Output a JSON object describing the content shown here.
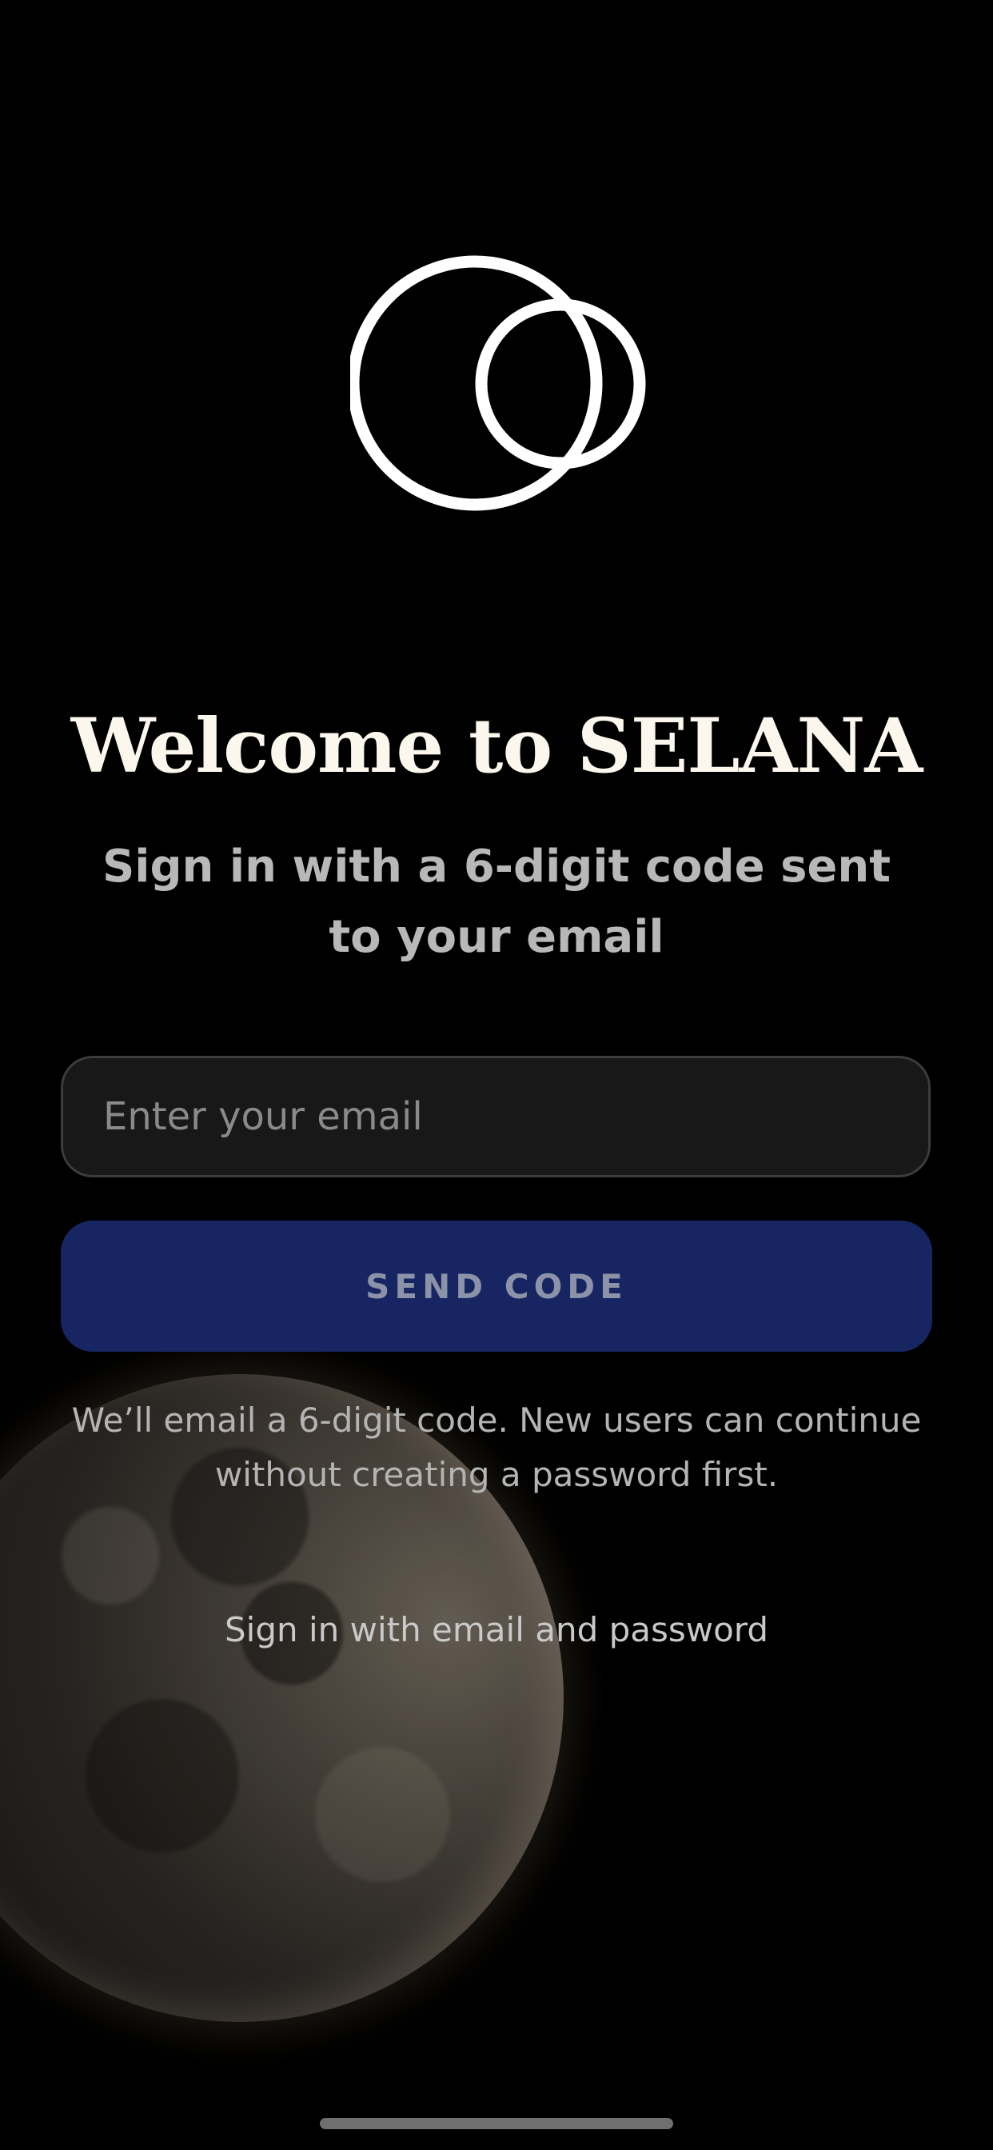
{
  "app": {
    "logo_icon": "selana-logo-icon",
    "title": "Welcome to SELANA",
    "subtitle": "Sign in with a 6-digit code sent to your email"
  },
  "form": {
    "email_value": "",
    "email_placeholder": "Enter your email",
    "send_button_label": "SEND CODE",
    "helper_text": "We’ll email a 6-digit code. New users can continue without creating a password first.",
    "password_link_label": "Sign in with email and password"
  },
  "colors": {
    "background": "#000000",
    "title_text": "#fbf7ec",
    "subtitle_text": "#b8b8b8",
    "input_background": "#181818",
    "input_border": "#3c3c3c",
    "button_background": "#172662",
    "button_text": "#8c93a8"
  }
}
